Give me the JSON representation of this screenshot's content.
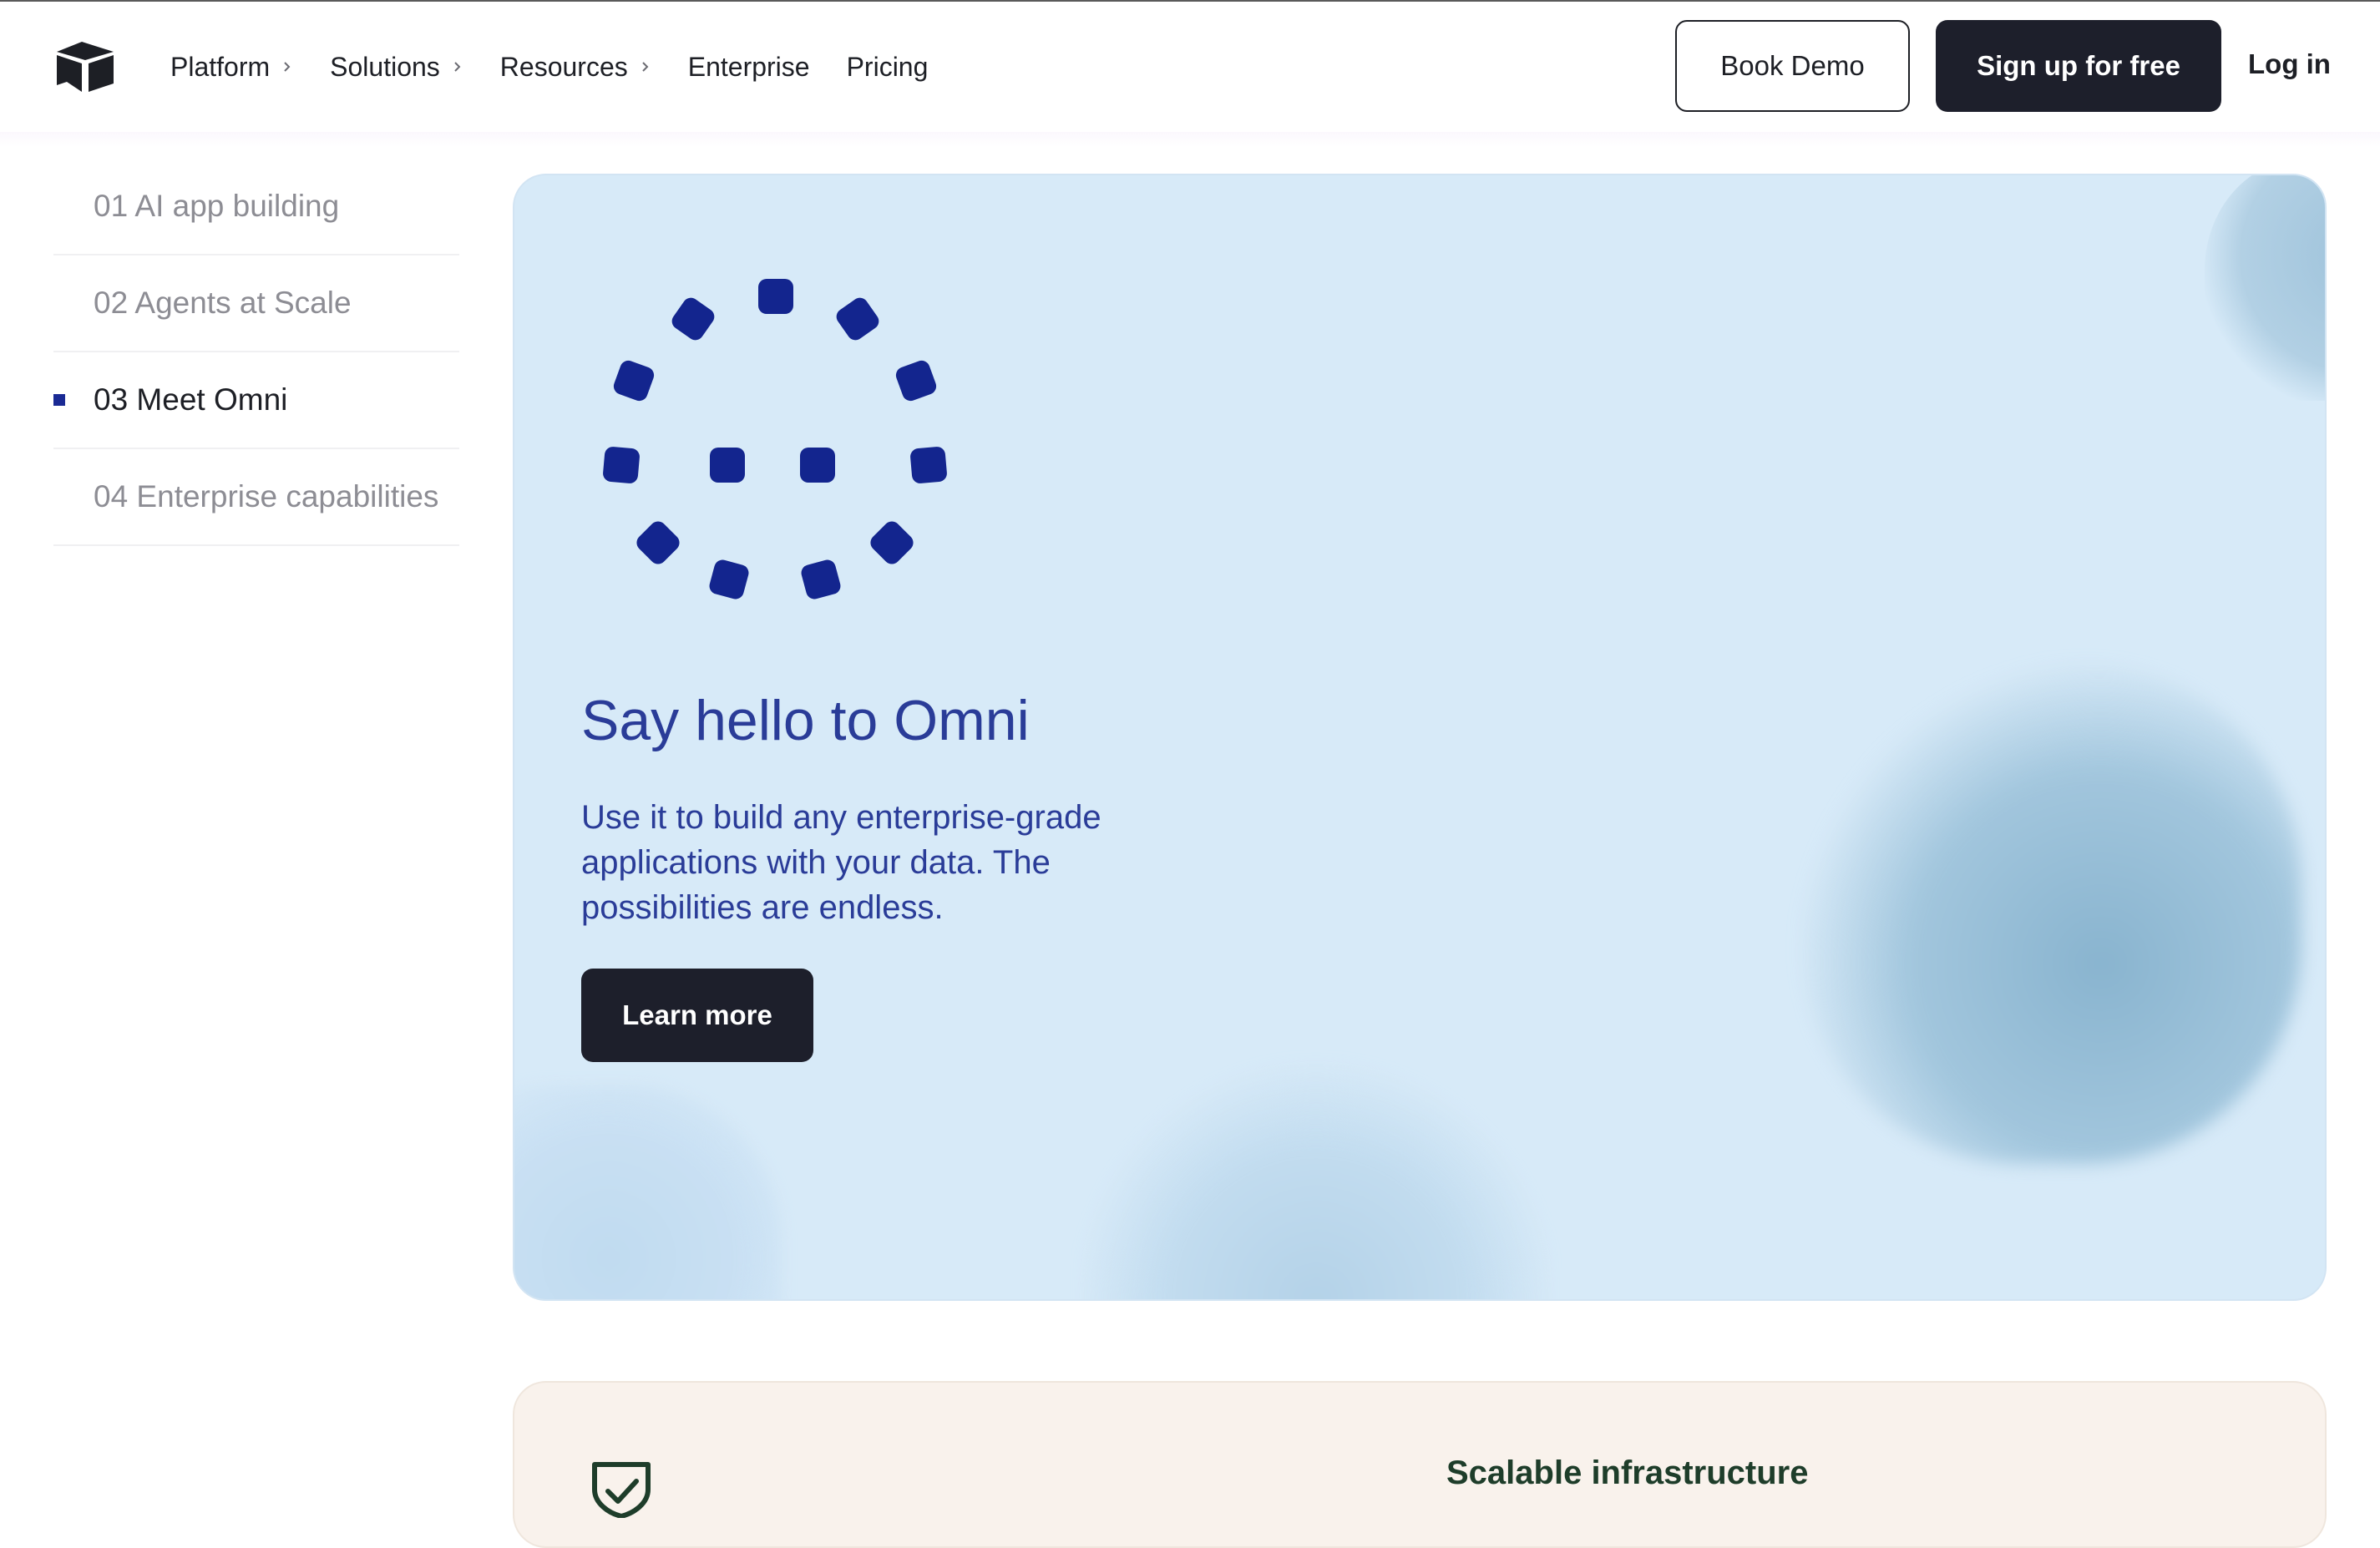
{
  "header": {
    "logo_icon": "cube-logo-icon",
    "nav": [
      {
        "label": "Platform",
        "has_submenu": true
      },
      {
        "label": "Solutions",
        "has_submenu": true
      },
      {
        "label": "Resources",
        "has_submenu": true
      },
      {
        "label": "Enterprise",
        "has_submenu": false
      },
      {
        "label": "Pricing",
        "has_submenu": false
      }
    ],
    "book_demo_label": "Book Demo",
    "signup_label": "Sign up for free",
    "login_label": "Log in"
  },
  "sidebar": {
    "items": [
      {
        "label": "01 AI app building",
        "active": false
      },
      {
        "label": "02 Agents at Scale",
        "active": false
      },
      {
        "label": "03 Meet Omni",
        "active": true
      },
      {
        "label": "04 Enterprise capabilities",
        "active": false
      }
    ]
  },
  "hero": {
    "icon": "omni-dots-icon",
    "title": "Say hello to Omni",
    "description": "Use it to build any enterprise-grade applications with your data. The possibilities are endless.",
    "button_label": "Learn more"
  },
  "feature": {
    "icon": "shield-check-icon",
    "title": "Scalable infrastructure"
  },
  "colors": {
    "accent": "#1a2a94",
    "hero_text": "#2a3c98",
    "hero_bg": "#d7eaf8",
    "dark_button": "#1d1f2b",
    "feature_bg": "#f9f2ec",
    "feature_title": "#1e3d2a"
  }
}
